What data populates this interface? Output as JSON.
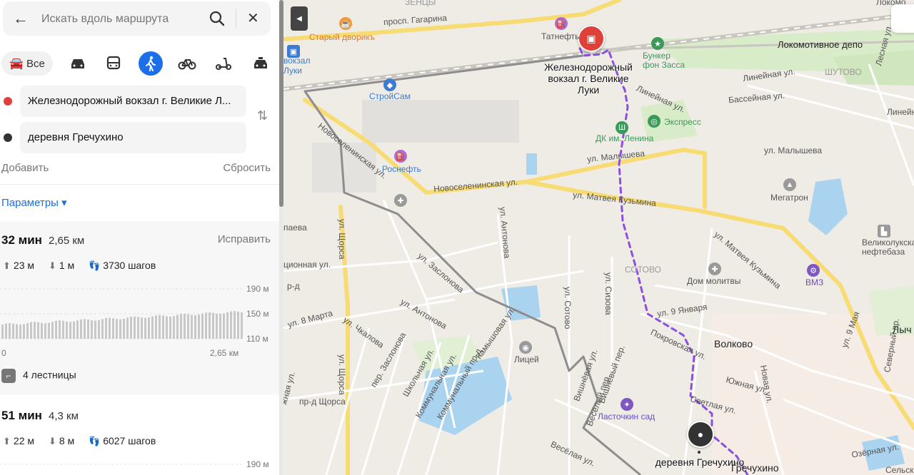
{
  "search": {
    "placeholder": "Искать вдоль маршрута"
  },
  "modes": {
    "all_label": "Все"
  },
  "route_points": {
    "from": "Железнодорожный вокзал г. Великие Л...",
    "to": "деревня Гречухино",
    "from_color": "#e0403a",
    "to_color": "#333333"
  },
  "actions": {
    "add": "Добавить",
    "reset": "Сбросить"
  },
  "params_label": "Параметры ▾",
  "routes": [
    {
      "time": "32 мин",
      "distance": "2,65 км",
      "fix_label": "Исправить",
      "ascent": "23 м",
      "descent": "1 м",
      "steps": "3730 шагов",
      "elev_labels": [
        "190 м",
        "150 м",
        "110 м"
      ],
      "x_start": "0",
      "x_end": "2,65 км",
      "stairs": "4 лестницы"
    },
    {
      "time": "51 мин",
      "distance": "4,3 км",
      "ascent": "22 м",
      "descent": "8 м",
      "steps": "6027 шагов",
      "elev_top": "190 м"
    }
  ],
  "map": {
    "streets": {
      "gagarina": "просп. Гагарина",
      "novoselen1": "Новоселенинская ул.",
      "novoselen2": "Новоселенинская ул.",
      "malysheva1": "ул. Малышева",
      "malysheva2": "ул. Малышева",
      "matveya1": "ул. Матвея Кузьмина",
      "matveya2": "ул. Матвея Кузьмина",
      "zaslonova": "ул. Заслонова",
      "schorsa1": "ул. Щорса",
      "schorsa2": "ул. Щорса",
      "pr_schorsa": "пр-д Щорса",
      "antonova1": "ул. Антонова",
      "antonova2": "ул. Антонова",
      "chkalova": "ул. Чкалова",
      "marta": "ул. 8 Марта",
      "zaslonova_per": "пер. Заслонова",
      "shkolnaya": "Школьная ул.",
      "kommunalnaya": "Коммунальная ул.",
      "kommunalny_pr": "Коммунальный пр-д",
      "kamyshovaya": "Камышовая ул.",
      "sotovo_st": "ул. Сотово",
      "sizova": "ул. Сизова",
      "yanvarya": "ул. 9 Января",
      "pokrovskaya": "Покровская ул.",
      "svetlaya": "Светлая ул.",
      "yuzhnaya": "Южная ул.",
      "novaya": "Новая ул.",
      "may9": "ул. 9 Мая",
      "severnaya": "Северный пр.",
      "ozernaya": "Озёрная ул.",
      "vesyolaya": "Весёлая ул.",
      "vesyoly_per": "Весёлый пер.",
      "vishnyovaya": "Вишнёвая ул.",
      "vishnyovy_per": "Вишнёвый пер.",
      "lineynaya1": "Линейная ул.",
      "lineynaya2": "Линейная ул.",
      "lineynaya3": "Линейная ул.",
      "basseynaya": "Бассейная ул.",
      "lessnaya": "Лесная ул.",
      "aeva": "паева",
      "tsionnaya": "ционная ул.",
      "prd": "р-д",
      "zhnaya": "жная ул."
    },
    "places": {
      "staryi_dvorik": "Старый дворикъ",
      "tatneft": "Татнефть",
      "vokzal_small": "вокзал\nЛуки",
      "vokzal_main": "Железнодорожный\nвокзал г. Великие\nЛуки",
      "bunker": "Бункер\nфон Засса",
      "depo": "Локомотивное депо",
      "shutovo": "ШУТОВО",
      "stroysam": "СтройСам",
      "express": "Экспресс",
      "dk": "ДК им. Ленина",
      "rosneft": "Роснефть",
      "megatron": "Мегатрон",
      "neftebaza": "Великолукская\nнефтебаза",
      "sotovo": "СОТОВО",
      "dom_molitvy": "Дом молитвы",
      "vmz": "ВМЗ",
      "volkovo": "Волково",
      "litsey": "Лицей",
      "lastochkin": "Ласточкин сад",
      "grechukhino_pin": "деревня Гречухино",
      "grechukhino": "Гречухино",
      "lych": "Лыч",
      "zentsy": "ЗЕНЦЫ",
      "lokomo_top": "Локомо",
      "selsk": "Сельск"
    }
  }
}
